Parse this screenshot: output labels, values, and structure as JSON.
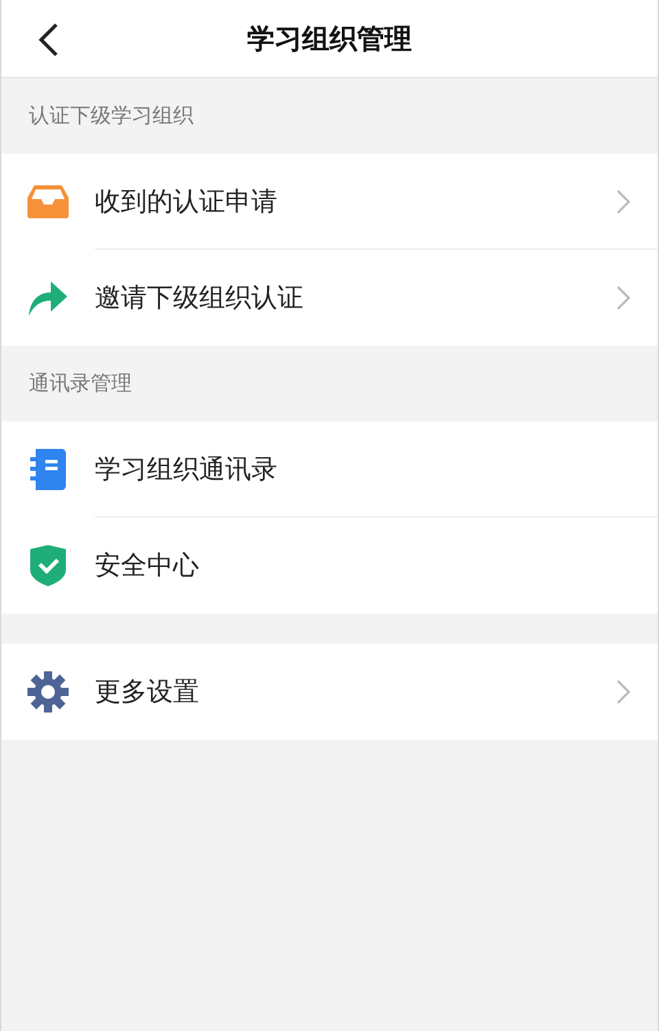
{
  "header": {
    "title": "学习组织管理"
  },
  "sections": [
    {
      "title": "认证下级学习组织",
      "items": [
        {
          "kind": "inbox",
          "label": "收到的认证申请",
          "chevron": true
        },
        {
          "kind": "share",
          "label": "邀请下级组织认证",
          "chevron": true
        }
      ]
    },
    {
      "title": "通讯录管理",
      "items": [
        {
          "kind": "book",
          "label": "学习组织通讯录",
          "chevron": false
        },
        {
          "kind": "shield",
          "label": "安全中心",
          "chevron": false
        }
      ]
    },
    {
      "items": [
        {
          "kind": "gear",
          "label": "更多设置",
          "chevron": true
        }
      ]
    }
  ]
}
